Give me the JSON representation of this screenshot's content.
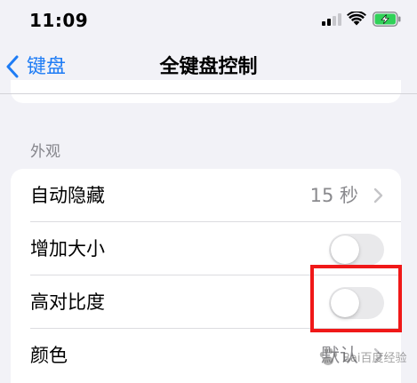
{
  "status_bar": {
    "time": "11:09",
    "battery_color": "#30d158"
  },
  "nav": {
    "back_label": "键盘",
    "title": "全键盘控制",
    "accent_color": "#1e7cf5"
  },
  "section": {
    "header": "外观"
  },
  "rows": [
    {
      "label": "自动隐藏",
      "value": "15 秒",
      "type": "disclosure"
    },
    {
      "label": "增加大小",
      "type": "toggle",
      "on": false
    },
    {
      "label": "高对比度",
      "type": "toggle",
      "on": false
    },
    {
      "label": "颜色",
      "value": "默认",
      "type": "disclosure"
    }
  ],
  "annotation": {
    "highlight_color": "#f01818"
  },
  "watermark": {
    "text": "Bai百度经验"
  }
}
